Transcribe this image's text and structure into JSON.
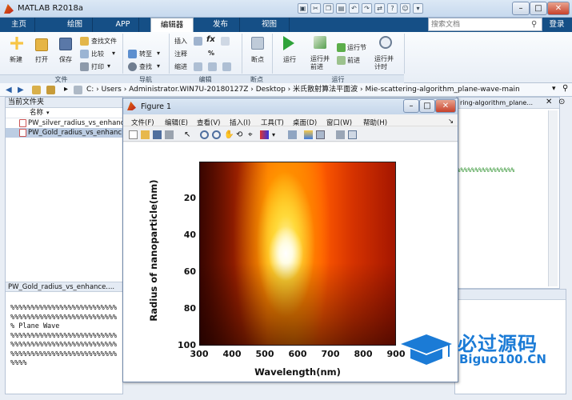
{
  "app": {
    "title": "MATLAB R2018a",
    "search_placeholder": "搜索文档",
    "login": "登录"
  },
  "tabs": [
    "主页",
    "绘图",
    "APP",
    "编辑器",
    "发布",
    "视图"
  ],
  "active_tab": "编辑器",
  "ribbon": {
    "file": {
      "new": "新建",
      "open": "打开",
      "save": "保存",
      "find_files": "查找文件",
      "compare": "比较",
      "print": "打印",
      "group": "文件"
    },
    "nav": {
      "goto": "转至",
      "find": "查找",
      "group": "导航"
    },
    "edit": {
      "insert": "插入",
      "comment": "注释",
      "indent": "缩进",
      "group": "编辑",
      "fx": "fx"
    },
    "breakpoints": {
      "label": "断点",
      "group": "断点"
    },
    "run": {
      "run": "运行",
      "run_advance": "运行并前进",
      "run_section": "运行节",
      "advance": "前进",
      "run_time": "运行并计时",
      "group": "运行"
    }
  },
  "address": {
    "path": "C: › Users › Administrator.WIN7U-20180127Z › Desktop › 米氏散射算法平面波 › Mie-scattering-algorithm_plane-wave-main"
  },
  "current_folder": {
    "title": "当前文件夹",
    "column": "名称",
    "files": [
      "PW_silver_radius_vs_enhanc...",
      "PW_Gold_radius_vs_enhanc..."
    ]
  },
  "editor_preview": {
    "title": "PW_Gold_radius_vs_enhance....",
    "lines": [
      "%%%%%%%%%%%%%%%%%%%%%%%%%%",
      "%%%%%%%%%%%%%%%%%%%%%%%%%%",
      "% Plane Wave",
      "%%%%%%%%%%%%%%%%%%%%%%%%%%",
      "%%%%%%%%%%%%%%%%%%%%%%%%%%",
      "%%%%%%%%%%%%%%%%%%%%%%%%%%",
      "%%%%"
    ]
  },
  "right_editor": {
    "tab_text": "ring-algorithm_plane...",
    "line_text": "%%%%%%%%%%%%%%%%"
  },
  "figure": {
    "title": "Figure 1",
    "menu": [
      "文件(F)",
      "编辑(E)",
      "查看(V)",
      "插入(I)",
      "工具(T)",
      "桌面(D)",
      "窗口(W)",
      "帮助(H)"
    ],
    "close_arrow": "↘"
  },
  "chart_data": {
    "type": "heatmap",
    "xlabel": "Wavelength(nm)",
    "ylabel": "Radius of nanoparticle(nm)",
    "xticks": [
      "300",
      "400",
      "500",
      "600",
      "700",
      "800",
      "900"
    ],
    "yticks": [
      "20",
      "40",
      "60",
      "80",
      "100"
    ],
    "xlim": [
      300,
      900
    ],
    "ylim": [
      0,
      100
    ],
    "y_direction": "reversed",
    "colormap": "hot",
    "peak": {
      "x": 550,
      "y": 55
    }
  },
  "watermark": {
    "brand": "必过源码",
    "domain": "Biguo100.CN"
  }
}
